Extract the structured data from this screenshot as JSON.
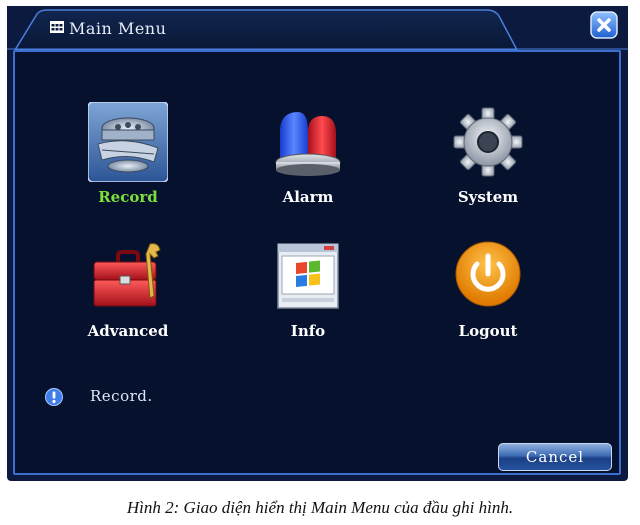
{
  "window": {
    "title": "Main Menu",
    "close_icon": "close-x-icon",
    "title_icon": "grid-menu-icon"
  },
  "menu": {
    "items": [
      {
        "label": "Record",
        "icon": "film-reel-icon",
        "selected": true
      },
      {
        "label": "Alarm",
        "icon": "siren-light-icon",
        "selected": false
      },
      {
        "label": "System",
        "icon": "gear-icon",
        "selected": false
      },
      {
        "label": "Advanced",
        "icon": "toolbox-icon",
        "selected": false
      },
      {
        "label": "Info",
        "icon": "info-window-icon",
        "selected": false
      },
      {
        "label": "Logout",
        "icon": "power-icon",
        "selected": false
      }
    ]
  },
  "status": {
    "text": "Record.",
    "icon": "info-icon"
  },
  "footer": {
    "cancel_label": "Cancel"
  },
  "caption": {
    "text": "Hình 2: Giao diện hiển thị Main Menu của đầu ghi hình."
  },
  "colors": {
    "window_bg": "#0b1a3e",
    "content_bg": "#06112e",
    "border": "#3a6fd0",
    "selected_label": "#7be13a"
  }
}
